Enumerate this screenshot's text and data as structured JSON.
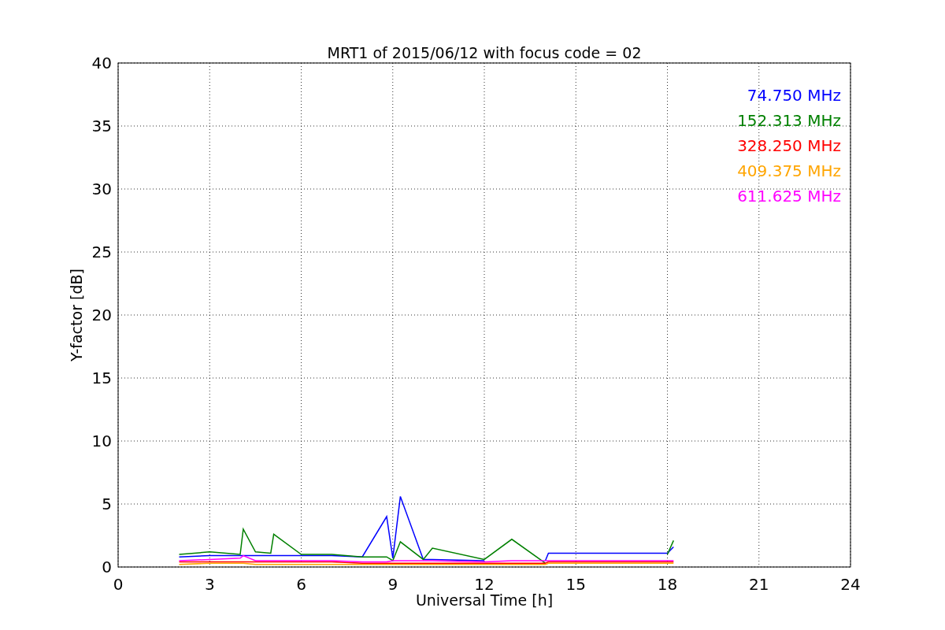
{
  "chart_data": {
    "type": "line",
    "title": "MRT1 of 2015/06/12 with focus code = 02",
    "xlabel": "Universal Time [h]",
    "ylabel": "Y-factor [dB]",
    "x": [
      2,
      3,
      4,
      4.1,
      4.5,
      5,
      5.1,
      6,
      7,
      8,
      8.8,
      9,
      9.25,
      10,
      10.3,
      12,
      12.9,
      14,
      14.1,
      16,
      18,
      18.2
    ],
    "series": [
      {
        "name": "74.750 MHz",
        "color": "#0000ff",
        "values": [
          0.8,
          0.9,
          0.9,
          0.9,
          0.9,
          0.9,
          0.9,
          0.9,
          0.9,
          0.8,
          4.0,
          0.7,
          5.6,
          0.6,
          0.6,
          0.5,
          null,
          0.5,
          1.1,
          1.1,
          1.1,
          1.6
        ]
      },
      {
        "name": "152.313 MHz",
        "color": "#008000",
        "values": [
          1.0,
          1.2,
          1.0,
          3.0,
          1.2,
          1.1,
          2.6,
          1.0,
          1.0,
          0.8,
          0.8,
          0.5,
          2.0,
          0.6,
          1.5,
          0.6,
          2.2,
          0.3,
          null,
          null,
          1.0,
          2.1
        ]
      },
      {
        "name": "328.250 MHz",
        "color": "#ff0000",
        "values": [
          0.4,
          0.4,
          0.4,
          0.4,
          0.4,
          0.4,
          0.4,
          0.4,
          0.4,
          0.3,
          0.3,
          0.3,
          0.3,
          0.3,
          0.3,
          0.3,
          0.3,
          0.3,
          0.4,
          0.4,
          0.4,
          0.4
        ]
      },
      {
        "name": "409.375 MHz",
        "color": "#ffa500",
        "values": [
          0.2,
          0.3,
          0.3,
          0.3,
          0.2,
          0.2,
          0.2,
          0.2,
          0.2,
          0.2,
          0.2,
          0.2,
          0.2,
          0.2,
          0.2,
          0.2,
          0.2,
          0.2,
          0.3,
          0.3,
          0.3,
          0.3
        ]
      },
      {
        "name": "611.625 MHz",
        "color": "#ff00ff",
        "values": [
          0.5,
          0.6,
          0.7,
          0.9,
          0.5,
          0.5,
          0.5,
          0.5,
          0.5,
          0.4,
          0.4,
          0.5,
          0.5,
          0.5,
          0.5,
          0.4,
          0.5,
          0.5,
          0.5,
          0.5,
          0.5,
          0.5
        ]
      }
    ],
    "grid": true,
    "xlim": [
      0,
      24
    ],
    "ylim": [
      0,
      40
    ],
    "xticks": [
      0,
      3,
      6,
      9,
      12,
      15,
      18,
      21,
      24
    ],
    "yticks": [
      0,
      5,
      10,
      15,
      20,
      25,
      30,
      35,
      40
    ]
  }
}
